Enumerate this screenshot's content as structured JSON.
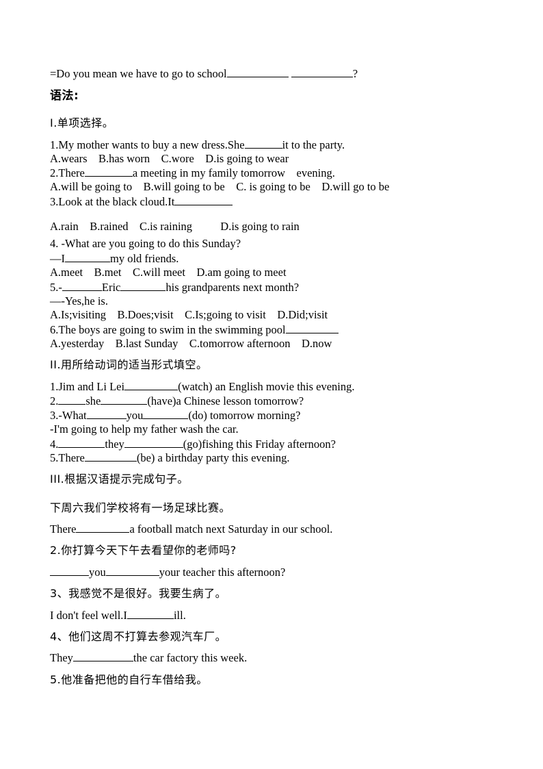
{
  "document": {
    "intro_line": {
      "before": "=Do you mean we have to go to school",
      "after": "?"
    },
    "grammar_heading": "语法:",
    "section1": {
      "title": "I.单项选择。",
      "questions": [
        {
          "stem_before": "1.My mother wants to buy a new dress.She",
          "stem_after": "it to the party.",
          "options": "A.wears    B.has worn    C.wore    D.is going to wear"
        },
        {
          "stem_before": "2.There",
          "stem_after": "a meeting in my family tomorrow    evening.",
          "options": "A.will be going to    B.will going to be    C. is going to be    D.will go to be"
        },
        {
          "stem_before": "3.Look at the black cloud.It",
          "stem_after": "",
          "options": "A.rain    B.rained    C.is raining          D.is going to rain"
        },
        {
          "stem": "4. -What are you going to do this Sunday?",
          "reply_before": "—I",
          "reply_after": "my old friends.",
          "options": "A.meet    B.met    C.will meet    D.am going to meet"
        },
        {
          "stem_a": "5.-",
          "stem_b": "Eric",
          "stem_c": "his grandparents next month?",
          "reply": "—-Yes,he is.",
          "options": "A.Is;visiting    B.Does;visit    C.Is;going to visit    D.Did;visit"
        },
        {
          "stem_before": "6.The boys are going to swim in the swimming pool",
          "stem_after": "",
          "options": "A.yesterday    B.last Sunday    C.tomorrow afternoon    D.now"
        }
      ]
    },
    "section2": {
      "title": "II.用所给动词的适当形式填空。",
      "items": [
        {
          "a": "1.Jim and Li Lei",
          "b": "(watch) an English movie this evening."
        },
        {
          "a": "2.",
          "b": "she",
          "c": "(have)a Chinese lesson tomorrow?"
        },
        {
          "a": "3.-What",
          "b": "you",
          "c": "(do) tomorrow morning?"
        },
        {
          "a": "-I'm going to help my father wash the car."
        },
        {
          "a": "4.",
          "b": "they",
          "c": "(go)fishing this Friday afternoon?"
        },
        {
          "a": "5.There",
          "b": "(be) a birthday party this evening."
        }
      ]
    },
    "section3": {
      "title": "III.根据汉语提示完成句子。",
      "items": [
        {
          "cn": "下周六我们学校将有一场足球比赛。",
          "en_a": "There",
          "en_b": "a football match next Saturday in our school."
        },
        {
          "cn": "2.你打算今天下午去看望你的老师吗?",
          "en_a": "you",
          "en_b": "your teacher this afternoon?"
        },
        {
          "cn": "3、我感觉不是很好。我要生病了。",
          "en_a": "I don't feel well.I",
          "en_b": "ill."
        },
        {
          "cn": "4、他们这周不打算去参观汽车厂。",
          "en_a": "They",
          "en_b": "the car factory this week."
        },
        {
          "cn": "5.他准备把他的自行车借给我。"
        }
      ]
    }
  }
}
